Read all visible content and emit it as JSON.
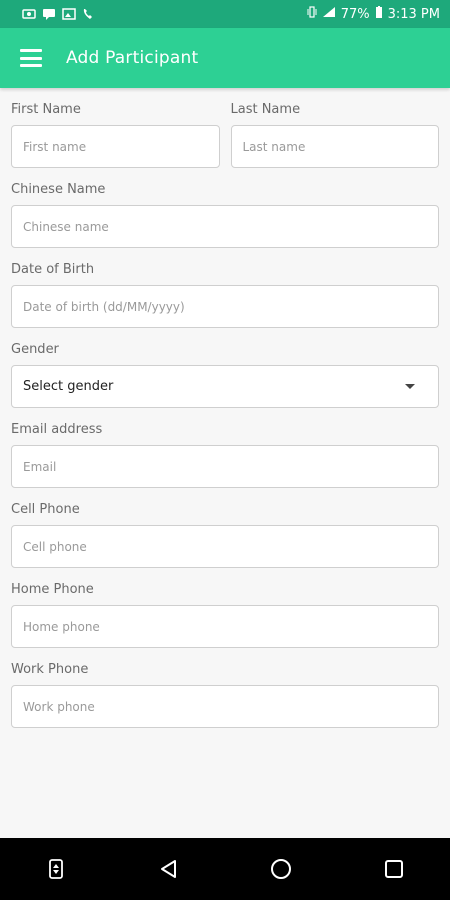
{
  "status_bar": {
    "battery": "77%",
    "time": "3:13 PM"
  },
  "app_bar": {
    "title": "Add Participant",
    "menu_icon": "hamburger-menu-icon"
  },
  "form": {
    "first_name": {
      "label": "First Name",
      "placeholder": "First name"
    },
    "last_name": {
      "label": "Last Name",
      "placeholder": "Last name"
    },
    "chinese_name": {
      "label": "Chinese Name",
      "placeholder": "Chinese name"
    },
    "date_of_birth": {
      "label": "Date of Birth",
      "placeholder": "Date of birth (dd/MM/yyyy)"
    },
    "gender": {
      "label": "Gender",
      "selected": "Select gender"
    },
    "email": {
      "label": "Email address",
      "placeholder": "Email"
    },
    "cell_phone": {
      "label": "Cell Phone",
      "placeholder": "Cell phone"
    },
    "home_phone": {
      "label": "Home Phone",
      "placeholder": "Home phone"
    },
    "work_phone": {
      "label": "Work Phone",
      "placeholder": "Work phone"
    }
  },
  "nav_bar": {
    "icons": [
      "sim-toolkit-icon",
      "back-icon",
      "home-icon",
      "recents-icon"
    ]
  },
  "colors": {
    "app_bar": "#2dd094",
    "status_bar": "#1ea97b"
  }
}
